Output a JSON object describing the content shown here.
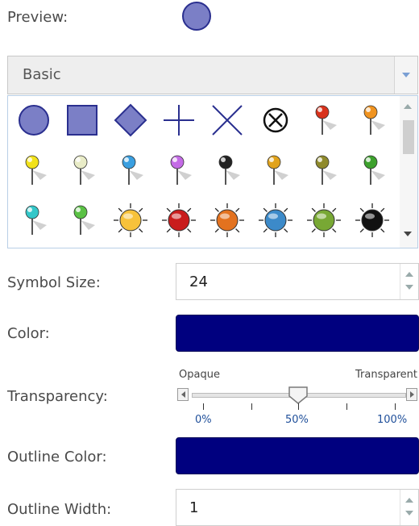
{
  "preview": {
    "label": "Preview:"
  },
  "category": {
    "selected": "Basic"
  },
  "symbols": [
    "circle-icon",
    "square-icon",
    "diamond-icon",
    "cross-icon",
    "x-icon",
    "circle-x-icon",
    "pin-red-icon",
    "pin-orange-icon",
    "pin-yellow-icon",
    "pin-white-icon",
    "pin-blue-icon",
    "pin-violet-icon",
    "pin-black-icon",
    "pin-gold-icon",
    "pin-olive-icon",
    "pin-green-icon",
    "pin-cyan-icon",
    "pin-lightgreen-icon",
    "sun-yellow-icon",
    "sun-red-icon",
    "sun-orange-icon",
    "sun-blue-icon",
    "sun-green-icon",
    "sun-black-icon"
  ],
  "symbol_colors": {
    "pin-red-icon": "#d8321c",
    "pin-orange-icon": "#f0931f",
    "pin-yellow-icon": "#f2e21b",
    "pin-white-icon": "#e9ecc7",
    "pin-blue-icon": "#3a9fe0",
    "pin-violet-icon": "#c46be6",
    "pin-black-icon": "#222222",
    "pin-gold-icon": "#e1a31c",
    "pin-olive-icon": "#8f8a2c",
    "pin-green-icon": "#3da12d",
    "pin-cyan-icon": "#33c7c9",
    "pin-lightgreen-icon": "#5ac145",
    "sun-yellow-icon": "#f7c23b",
    "sun-red-icon": "#c91c1c",
    "sun-orange-icon": "#e3721f",
    "sun-blue-icon": "#3c8ac9",
    "sun-green-icon": "#78a834",
    "sun-black-icon": "#111111"
  },
  "symbol_size": {
    "label": "Symbol Size:",
    "value": "24"
  },
  "color": {
    "label": "Color:",
    "value": "#00007f"
  },
  "transparency": {
    "label": "Transparency:",
    "left_label": "Opaque",
    "right_label": "Transparent",
    "value": 0.5,
    "ticks": [
      "0%",
      "50%",
      "100%"
    ]
  },
  "outline_color": {
    "label": "Outline Color:",
    "value": "#00007f"
  },
  "outline_width": {
    "label": "Outline Width:",
    "value": "1"
  }
}
